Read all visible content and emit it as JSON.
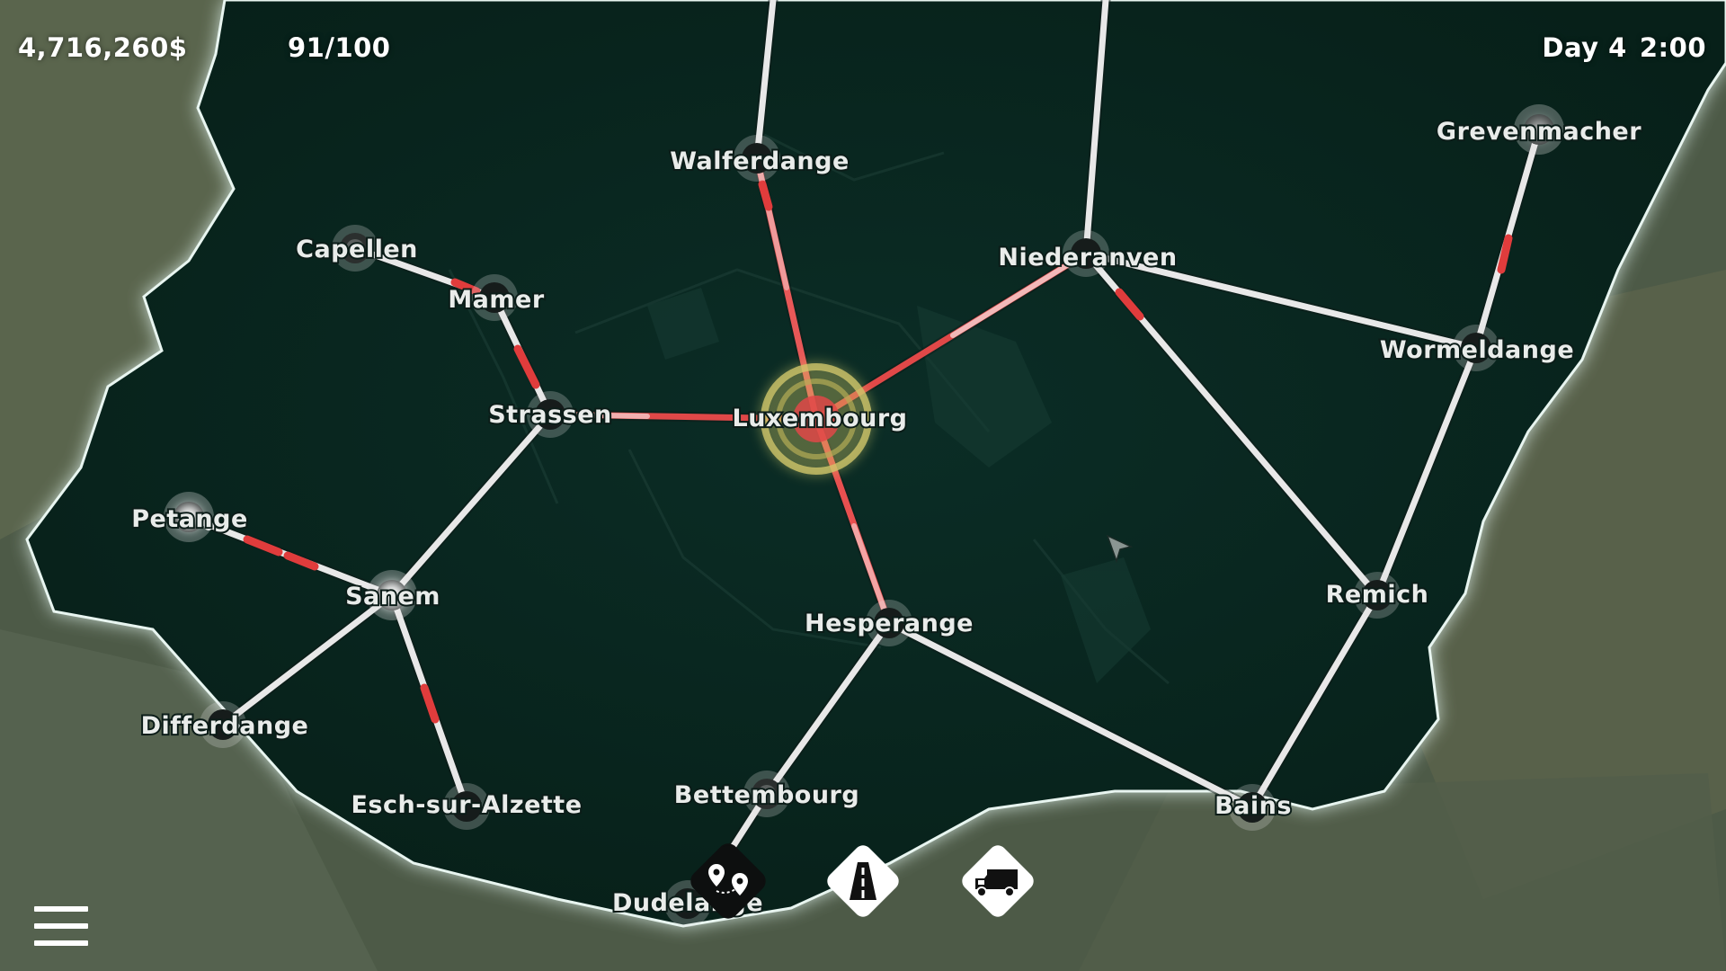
{
  "hud": {
    "money": "4,716,260$",
    "count": "91/100",
    "day": "Day 4",
    "time": "2:00"
  },
  "cities": {
    "walferdange": "Walferdange",
    "capellen": "Capellen",
    "mamer": "Mamer",
    "strassen": "Strassen",
    "luxembourg": "Luxembourg",
    "niederanven": "Niederanven",
    "grevenmacher": "Grevenmacher",
    "wormeldange": "Wormeldange",
    "petange": "Petange",
    "sanem": "Sanem",
    "differdange": "Differdange",
    "esch": "Esch-sur-Alzette",
    "hesperange": "Hesperange",
    "remich": "Remich",
    "bettembourg": "Bettembourg",
    "bains": "Bains",
    "dudelange": "Dudelange"
  },
  "toolbar": {
    "route_icon": "route-pins-icon",
    "road_icon": "road-icon",
    "truck_icon": "truck-icon",
    "menu_icon": "hamburger-menu-icon"
  },
  "colors": {
    "background": "#0a2a22",
    "road": "#e6e6e6",
    "congested": "#e03c3c",
    "selected_ring": "#d8cf6a",
    "border_glow": "#d9efe8"
  }
}
